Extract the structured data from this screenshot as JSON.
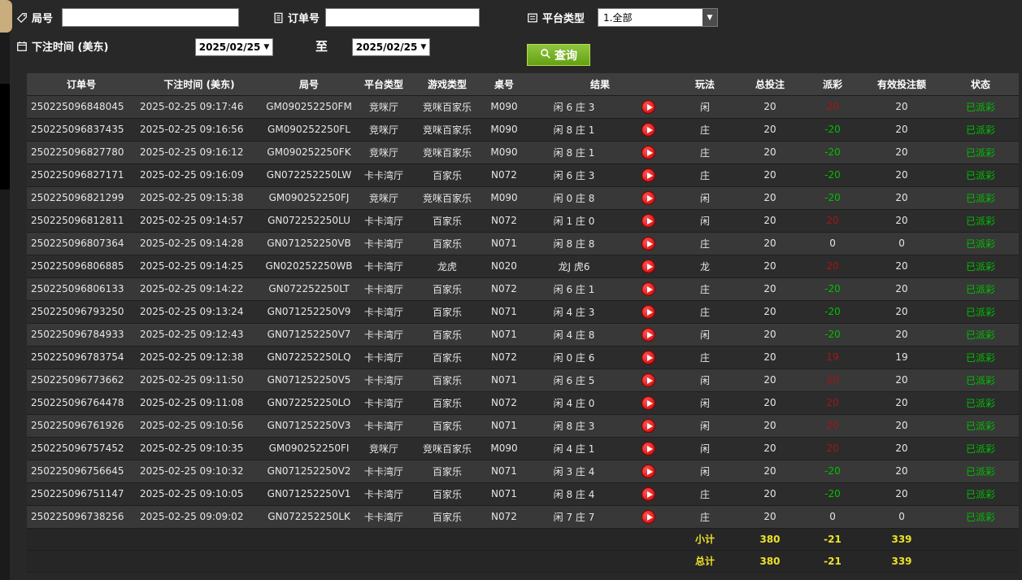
{
  "filters": {
    "round": {
      "label": "局号",
      "value": ""
    },
    "order": {
      "label": "订单号",
      "value": ""
    },
    "platform": {
      "label": "平台类型",
      "value": "1.全部"
    },
    "bet_time": {
      "label": "下注时间 (美东)",
      "from": "2025/02/25",
      "to_label": "至",
      "to": "2025/02/25"
    },
    "query": {
      "label": "查询"
    }
  },
  "table": {
    "columns": [
      "订单号",
      "下注时间 (美东)",
      "局号",
      "平台类型",
      "游戏类型",
      "桌号",
      "结果",
      "玩法",
      "总投注",
      "派彩",
      "有效投注额",
      "状态"
    ],
    "rows": [
      {
        "order": "250225096848045",
        "time": "2025-02-25 09:17:46",
        "round": "GM090252250FM",
        "platform": "竞咪厅",
        "game": "竞咪百家乐",
        "table_no": "M090",
        "result": "闲 6 庄 3",
        "bet_type": "闲",
        "total_bet": "20",
        "payout": "20",
        "payout_color": "red",
        "valid_bet": "20",
        "status": "已派彩"
      },
      {
        "order": "250225096837435",
        "time": "2025-02-25 09:16:56",
        "round": "GM090252250FL",
        "platform": "竞咪厅",
        "game": "竞咪百家乐",
        "table_no": "M090",
        "result": "闲 8 庄 1",
        "bet_type": "庄",
        "total_bet": "20",
        "payout": "-20",
        "payout_color": "green",
        "valid_bet": "20",
        "status": "已派彩"
      },
      {
        "order": "250225096827780",
        "time": "2025-02-25 09:16:12",
        "round": "GM090252250FK",
        "platform": "竞咪厅",
        "game": "竞咪百家乐",
        "table_no": "M090",
        "result": "闲 8 庄 1",
        "bet_type": "庄",
        "total_bet": "20",
        "payout": "-20",
        "payout_color": "green",
        "valid_bet": "20",
        "status": "已派彩"
      },
      {
        "order": "250225096827171",
        "time": "2025-02-25 09:16:09",
        "round": "GN072252250LW",
        "platform": "卡卡湾厅",
        "game": "百家乐",
        "table_no": "N072",
        "result": "闲 6 庄 3",
        "bet_type": "庄",
        "total_bet": "20",
        "payout": "-20",
        "payout_color": "green",
        "valid_bet": "20",
        "status": "已派彩"
      },
      {
        "order": "250225096821299",
        "time": "2025-02-25 09:15:38",
        "round": "GM090252250FJ",
        "platform": "竞咪厅",
        "game": "竞咪百家乐",
        "table_no": "M090",
        "result": "闲 0 庄 8",
        "bet_type": "闲",
        "total_bet": "20",
        "payout": "-20",
        "payout_color": "green",
        "valid_bet": "20",
        "status": "已派彩"
      },
      {
        "order": "250225096812811",
        "time": "2025-02-25 09:14:57",
        "round": "GN072252250LU",
        "platform": "卡卡湾厅",
        "game": "百家乐",
        "table_no": "N072",
        "result": "闲 1 庄 0",
        "bet_type": "闲",
        "total_bet": "20",
        "payout": "20",
        "payout_color": "red",
        "valid_bet": "20",
        "status": "已派彩"
      },
      {
        "order": "250225096807364",
        "time": "2025-02-25 09:14:28",
        "round": "GN071252250VB",
        "platform": "卡卡湾厅",
        "game": "百家乐",
        "table_no": "N071",
        "result": "闲 8 庄 8",
        "bet_type": "庄",
        "total_bet": "20",
        "payout": "0",
        "payout_color": "white",
        "valid_bet": "0",
        "status": "已派彩"
      },
      {
        "order": "250225096806885",
        "time": "2025-02-25 09:14:25",
        "round": "GN020252250WB",
        "platform": "卡卡湾厅",
        "game": "龙虎",
        "table_no": "N020",
        "result": "龙J 虎6",
        "bet_type": "龙",
        "total_bet": "20",
        "payout": "20",
        "payout_color": "red",
        "valid_bet": "20",
        "status": "已派彩"
      },
      {
        "order": "250225096806133",
        "time": "2025-02-25 09:14:22",
        "round": "GN072252250LT",
        "platform": "卡卡湾厅",
        "game": "百家乐",
        "table_no": "N072",
        "result": "闲 6 庄 1",
        "bet_type": "庄",
        "total_bet": "20",
        "payout": "-20",
        "payout_color": "green",
        "valid_bet": "20",
        "status": "已派彩"
      },
      {
        "order": "250225096793250",
        "time": "2025-02-25 09:13:24",
        "round": "GN071252250V9",
        "platform": "卡卡湾厅",
        "game": "百家乐",
        "table_no": "N071",
        "result": "闲 4 庄 3",
        "bet_type": "庄",
        "total_bet": "20",
        "payout": "-20",
        "payout_color": "green",
        "valid_bet": "20",
        "status": "已派彩"
      },
      {
        "order": "250225096784933",
        "time": "2025-02-25 09:12:43",
        "round": "GN071252250V7",
        "platform": "卡卡湾厅",
        "game": "百家乐",
        "table_no": "N071",
        "result": "闲 4 庄 8",
        "bet_type": "闲",
        "total_bet": "20",
        "payout": "-20",
        "payout_color": "green",
        "valid_bet": "20",
        "status": "已派彩"
      },
      {
        "order": "250225096783754",
        "time": "2025-02-25 09:12:38",
        "round": "GN072252250LQ",
        "platform": "卡卡湾厅",
        "game": "百家乐",
        "table_no": "N072",
        "result": "闲 0 庄 6",
        "bet_type": "庄",
        "total_bet": "20",
        "payout": "19",
        "payout_color": "red",
        "valid_bet": "19",
        "status": "已派彩"
      },
      {
        "order": "250225096773662",
        "time": "2025-02-25 09:11:50",
        "round": "GN071252250V5",
        "platform": "卡卡湾厅",
        "game": "百家乐",
        "table_no": "N071",
        "result": "闲 6 庄 5",
        "bet_type": "闲",
        "total_bet": "20",
        "payout": "20",
        "payout_color": "red",
        "valid_bet": "20",
        "status": "已派彩"
      },
      {
        "order": "250225096764478",
        "time": "2025-02-25 09:11:08",
        "round": "GN072252250LO",
        "platform": "卡卡湾厅",
        "game": "百家乐",
        "table_no": "N072",
        "result": "闲 4 庄 0",
        "bet_type": "闲",
        "total_bet": "20",
        "payout": "20",
        "payout_color": "red",
        "valid_bet": "20",
        "status": "已派彩"
      },
      {
        "order": "250225096761926",
        "time": "2025-02-25 09:10:56",
        "round": "GN071252250V3",
        "platform": "卡卡湾厅",
        "game": "百家乐",
        "table_no": "N071",
        "result": "闲 8 庄 3",
        "bet_type": "闲",
        "total_bet": "20",
        "payout": "20",
        "payout_color": "red",
        "valid_bet": "20",
        "status": "已派彩"
      },
      {
        "order": "250225096757452",
        "time": "2025-02-25 09:10:35",
        "round": "GM090252250FI",
        "platform": "竞咪厅",
        "game": "竞咪百家乐",
        "table_no": "M090",
        "result": "闲 4 庄 1",
        "bet_type": "闲",
        "total_bet": "20",
        "payout": "20",
        "payout_color": "red",
        "valid_bet": "20",
        "status": "已派彩"
      },
      {
        "order": "250225096756645",
        "time": "2025-02-25 09:10:32",
        "round": "GN071252250V2",
        "platform": "卡卡湾厅",
        "game": "百家乐",
        "table_no": "N071",
        "result": "闲 3 庄 4",
        "bet_type": "闲",
        "total_bet": "20",
        "payout": "-20",
        "payout_color": "green",
        "valid_bet": "20",
        "status": "已派彩"
      },
      {
        "order": "250225096751147",
        "time": "2025-02-25 09:10:05",
        "round": "GN071252250V1",
        "platform": "卡卡湾厅",
        "game": "百家乐",
        "table_no": "N071",
        "result": "闲 8 庄 4",
        "bet_type": "庄",
        "total_bet": "20",
        "payout": "-20",
        "payout_color": "green",
        "valid_bet": "20",
        "status": "已派彩"
      },
      {
        "order": "250225096738256",
        "time": "2025-02-25 09:09:02",
        "round": "GN072252250LK",
        "platform": "卡卡湾厅",
        "game": "百家乐",
        "table_no": "N072",
        "result": "闲 7 庄 7",
        "bet_type": "庄",
        "total_bet": "20",
        "payout": "0",
        "payout_color": "white",
        "valid_bet": "0",
        "status": "已派彩"
      }
    ],
    "footer": [
      {
        "label": "小计",
        "total_bet": "380",
        "payout": "-21",
        "valid_bet": "339"
      },
      {
        "label": "总计",
        "total_bet": "380",
        "payout": "-21",
        "valid_bet": "339"
      }
    ]
  },
  "colors": {
    "payout_win": "#a81414",
    "payout_loss": "#00c000",
    "status_paid": "#00c000",
    "summary_text": "#ece22a",
    "query_button": "#76ab28"
  }
}
